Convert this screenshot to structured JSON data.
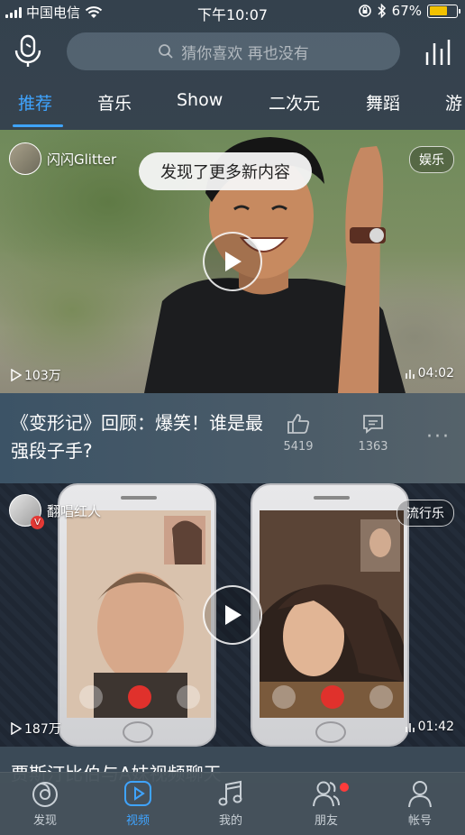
{
  "status_bar": {
    "carrier": "中国电信",
    "time": "下午10:07",
    "battery_percent": "67%",
    "battery_level": 0.67
  },
  "search": {
    "placeholder": "猜你喜欢 再也没有"
  },
  "tabs": [
    {
      "label": "推荐",
      "active": true
    },
    {
      "label": "音乐",
      "active": false
    },
    {
      "label": "Show",
      "active": false
    },
    {
      "label": "二次元",
      "active": false
    },
    {
      "label": "舞蹈",
      "active": false
    },
    {
      "label": "游",
      "active": false
    }
  ],
  "toast": "发现了更多新内容",
  "videos": [
    {
      "author": "闪闪Glitter",
      "category": "娱乐",
      "plays": "103万",
      "duration": "04:02",
      "title": "《变形记》回顾：爆笑！谁是最强段子手?",
      "likes": "5419",
      "comments": "1363"
    },
    {
      "author": "翻唱红人",
      "category": "流行乐",
      "plays": "187万",
      "duration": "01:42",
      "title": "贾斯汀比伯与A妹视频聊天"
    }
  ],
  "bottom_nav": [
    {
      "label": "发现",
      "icon": "discover-icon",
      "active": false
    },
    {
      "label": "视频",
      "icon": "video-icon",
      "active": true
    },
    {
      "label": "我的",
      "icon": "music-note-icon",
      "active": false
    },
    {
      "label": "朋友",
      "icon": "friends-icon",
      "active": false,
      "badge": true
    },
    {
      "label": "帐号",
      "icon": "account-icon",
      "active": false
    }
  ],
  "colors": {
    "accent": "#3fa4ff",
    "battery": "#f2c200",
    "badge": "#ff3b3b"
  }
}
